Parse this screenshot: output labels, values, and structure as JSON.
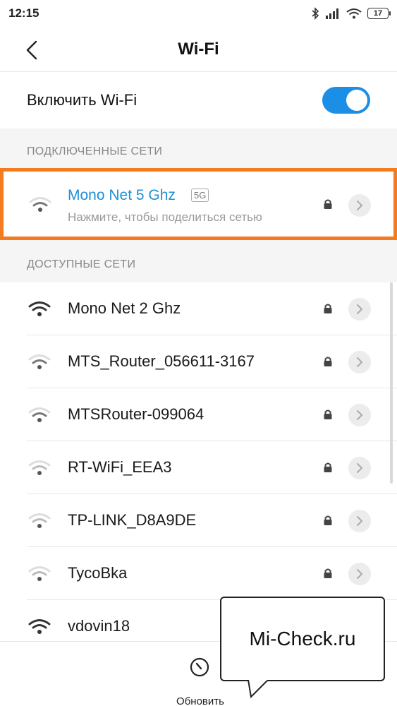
{
  "status_bar": {
    "time": "12:15",
    "battery": "17"
  },
  "header": {
    "title": "Wi-Fi"
  },
  "toggle": {
    "label": "Включить Wi-Fi",
    "on": true
  },
  "connected": {
    "section_title": "ПОДКЛЮЧЕННЫЕ СЕТИ",
    "network": {
      "name": "Mono Net 5 Ghz",
      "badge": "5G",
      "subtitle": "Нажмите, чтобы поделиться сетью",
      "secured": true,
      "signal_icon": "wifi-signal-icon"
    }
  },
  "available": {
    "section_title": "ДОСТУПНЫЕ СЕТИ",
    "networks": [
      {
        "name": "Mono Net 2 Ghz",
        "secured": true,
        "signal": "full"
      },
      {
        "name": "MTS_Router_056611-3167",
        "secured": true,
        "signal": "weak"
      },
      {
        "name": "MTSRouter-099064",
        "secured": true,
        "signal": "weak"
      },
      {
        "name": "RT-WiFi_EEA3",
        "secured": true,
        "signal": "weak"
      },
      {
        "name": "TP-LINK_D8A9DE",
        "secured": true,
        "signal": "weak"
      },
      {
        "name": "TycoBka",
        "secured": true,
        "signal": "weak"
      },
      {
        "name": "vdovin18",
        "secured": false,
        "signal": "full"
      }
    ]
  },
  "bottom": {
    "refresh_label": "Обновить"
  },
  "watermark": {
    "text": "Mi-Check.ru"
  },
  "colors": {
    "accent": "#1b8ee6",
    "highlight": "#f47b20",
    "link": "#1e8fd6"
  }
}
